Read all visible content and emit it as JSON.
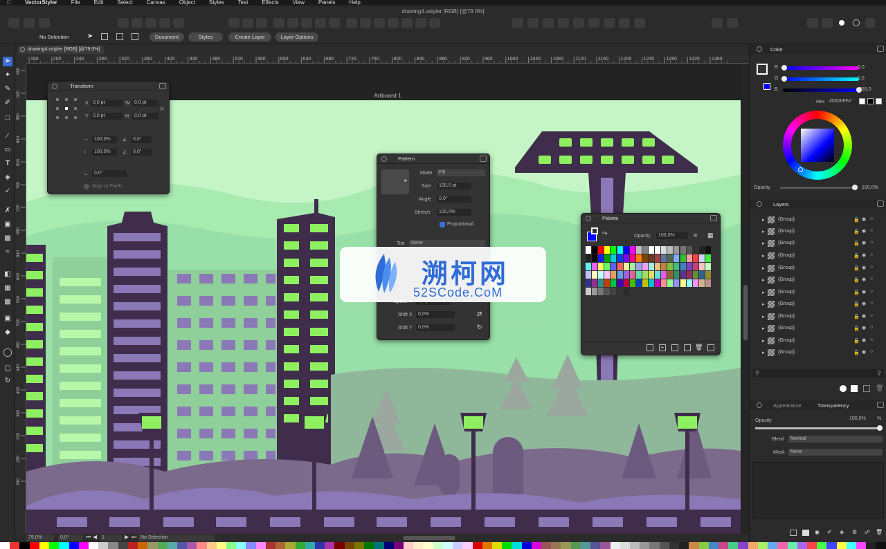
{
  "menubar": {
    "app_name": "VectorStyler",
    "items": [
      "File",
      "Edit",
      "Select",
      "Canvas",
      "Object",
      "Styles",
      "Text",
      "Effects",
      "View",
      "Panels",
      "Help"
    ]
  },
  "window": {
    "title": "drawing4.vstyler [RGB] [@79.0%]"
  },
  "context_bar": {
    "selection_label": "No Selection",
    "buttons": [
      "Document",
      "Styles",
      "Create Layer",
      "Layer Options"
    ]
  },
  "document_tab": {
    "label": "drawing4.vstyler [RGB] [@79.0%]"
  },
  "ruler": {
    "h_labels": [
      "160",
      "200",
      "240",
      "280",
      "320",
      "360",
      "400",
      "440",
      "480",
      "520",
      "560",
      "600",
      "640",
      "680",
      "720",
      "760",
      "800",
      "840",
      "880",
      "920",
      "960",
      "1000",
      "1040",
      "1080",
      "1120",
      "1160",
      "1200",
      "1240",
      "1280",
      "1320",
      "1360"
    ],
    "v_labels": [
      "960",
      "920",
      "880",
      "840",
      "800",
      "760",
      "720",
      "680",
      "640",
      "600",
      "560",
      "520",
      "480",
      "440",
      "400",
      "360",
      "320",
      "280",
      "240"
    ]
  },
  "artboard": {
    "label": "Artboard 1"
  },
  "transform_panel": {
    "title": "Transform",
    "x_label": "X",
    "x_value": "0,0 pt",
    "y_label": "Y",
    "y_value": "0,0 pt",
    "w_label": "W",
    "w_value": "0,0 pt",
    "h_label": "H",
    "h_value": "0,0 pt",
    "scale_x": "100,0%",
    "scale_y": "100,0%",
    "skew_x": "0,0°",
    "skew_y": "0,0°",
    "rotation": "0,0°",
    "align_pixels": "Align to Pixels"
  },
  "pattern_panel": {
    "title": "Pattern",
    "mode_label": "Mode",
    "mode_value": "Fill",
    "size_label": "Size",
    "size_value": "100,0 pt",
    "angle_label": "Angle",
    "angle_value": "0,0°",
    "stretch_label": "Stretch",
    "stretch_value": "100,0%",
    "proportional_label": "Proportional",
    "tint_label": "Tint",
    "tint_value": "None",
    "spacey_label": "Space Y",
    "spacey_value": "0,0 pt",
    "shiftx_label": "Shift X",
    "shiftx_value": "0,0%",
    "shifty_label": "Shift Y",
    "shifty_value": "0,0%"
  },
  "palette_panel": {
    "title": "Palette",
    "opacity_label": "Opacity",
    "opacity_value": "100,0%"
  },
  "color_panel": {
    "tab": "Color",
    "r_label": "R",
    "r_value": "0,0",
    "g_label": "G",
    "g_value": "0,0",
    "b_label": "B",
    "b_value": "255,0",
    "hex_label": "Hex",
    "hex_value": "#0000FF",
    "opacity_label": "Opacity",
    "opacity_value": "100,0%",
    "current_color": "#0000FF"
  },
  "layers_panel": {
    "tab": "Layers",
    "rows": [
      "{Group}",
      "{Group}",
      "{Group}",
      "{Group}",
      "{Group}",
      "{Group}",
      "{Group}",
      "{Group}",
      "{Group}",
      "{Group}",
      "{Group}",
      "{Group}"
    ]
  },
  "transparency_panel": {
    "tab_appearance": "Appearance",
    "tab_transparency": "Transparency",
    "opacity_label": "Opacity",
    "opacity_value": "100,0%",
    "opacity_unit": "%",
    "blend_label": "Blend",
    "blend_value": "Normal",
    "mask_label": "Mask",
    "mask_value": "None"
  },
  "statusbar": {
    "zoom": "79,0%",
    "rotation": "0,0°",
    "artboard_num": "1",
    "selection": "No Selection"
  },
  "watermark": {
    "title": "溯柯网",
    "url": "52SCode.CoM"
  },
  "colors": {
    "accent_blue": "#0000FF",
    "sky": "#c5f5c7",
    "building_dark": "#3f2d4b",
    "window_purple": "#8b78b6",
    "window_green": "#b7f7a9",
    "lamp_green": "#8ef060"
  }
}
